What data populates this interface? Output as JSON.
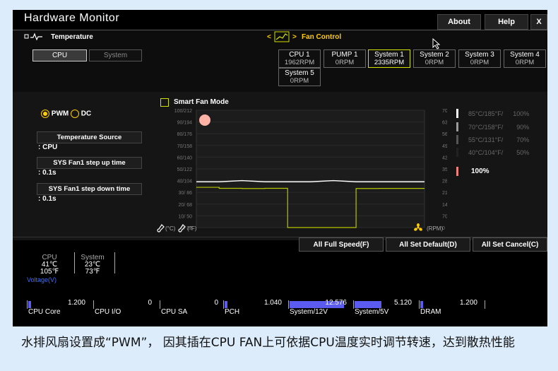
{
  "app": {
    "title": "Hardware Monitor"
  },
  "topbar": {
    "about": "About",
    "help": "Help",
    "close": "X"
  },
  "temperature": {
    "label": "Temperature",
    "tabs": [
      "CPU",
      "System"
    ]
  },
  "fan_control": {
    "label": "Fan Control",
    "prev": "<",
    "next": ">"
  },
  "fans": [
    {
      "name": "CPU 1",
      "rpm": "1962RPM"
    },
    {
      "name": "PUMP 1",
      "rpm": "0RPM"
    },
    {
      "name": "System 1",
      "rpm": "2335RPM",
      "selected": true
    },
    {
      "name": "System 2",
      "rpm": "0RPM"
    },
    {
      "name": "System 3",
      "rpm": "0RPM"
    },
    {
      "name": "System 4",
      "rpm": "0RPM"
    },
    {
      "name": "System 5",
      "rpm": "0RPM"
    }
  ],
  "mode": {
    "pwm": "PWM",
    "dc": "DC",
    "selected": "PWM"
  },
  "settings": {
    "temp_source_label": "Temperature Source",
    "temp_source_value": ": CPU",
    "step_up_label": "SYS Fan1 step up time",
    "step_up_value": ": 0.1s",
    "step_down_label": "SYS Fan1 step down time",
    "step_down_value": ": 0.1s"
  },
  "smart_fan": {
    "label": "Smart Fan Mode",
    "checked": false
  },
  "chart": {
    "left_ticks": [
      "100/212",
      "90/194",
      "80/176",
      "70/158",
      "60/140",
      "50/122",
      "40/104",
      "30/ 86",
      "20/ 68",
      "10/ 50",
      "0/ 32"
    ],
    "right_ticks": [
      "7000",
      "6300",
      "5600",
      "4900",
      "4200",
      "3500",
      "2800",
      "2100",
      "1400",
      "700",
      "0"
    ],
    "left_unit_c": "(°C)",
    "left_unit_f": "(°F)",
    "right_unit": "(RPM)",
    "legend": [
      {
        "text": "85°C/185°F/",
        "pct": "100%",
        "color": "#ffffff"
      },
      {
        "text": "70°C/158°F/",
        "pct": "90%",
        "color": "#9a9a9a"
      },
      {
        "text": "55°C/131°F/",
        "pct": "70%",
        "color": "#555555"
      },
      {
        "text": "40°C/104°F/",
        "pct": "50%",
        "color": "#222222"
      }
    ],
    "current_pct": "100%"
  },
  "chart_data": {
    "type": "line",
    "title": "",
    "xlabel": "",
    "ylabel": "(°C)",
    "y2label": "(RPM)",
    "ylim": [
      0,
      100
    ],
    "y2lim": [
      0,
      7000
    ],
    "grid": true,
    "series": [
      {
        "x": [
          0,
          1,
          2,
          3,
          4,
          5,
          6,
          7,
          8,
          9,
          10
        ],
        "values": [
          39,
          39,
          40,
          39,
          39,
          39,
          40,
          39,
          39,
          39,
          39
        ],
        "color": "#ffffff"
      },
      {
        "x": [
          0,
          1,
          2,
          3,
          4,
          5,
          6,
          7,
          8,
          9,
          10
        ],
        "values": [
          2400,
          2340,
          2330,
          2340,
          0,
          0,
          0,
          2330,
          2335,
          2335,
          2335
        ],
        "color": "#b5c400"
      }
    ]
  },
  "actions": {
    "full_speed": "All Full Speed(F)",
    "set_default": "All Set Default(D)",
    "set_cancel": "All Set Cancel(C)"
  },
  "monitor": {
    "cpu": {
      "label": "CPU",
      "c": "41℃",
      "f": "105℉"
    },
    "system": {
      "label": "System",
      "c": "23℃",
      "f": "73℉"
    },
    "voltage_label": "Voltage(V)"
  },
  "voltages": [
    {
      "name": "CPU Core",
      "value": "1.200",
      "fill": 0.04
    },
    {
      "name": "CPU I/O",
      "value": "0",
      "fill": 0
    },
    {
      "name": "CPU SA",
      "value": "0",
      "fill": 0
    },
    {
      "name": "PCH",
      "value": "1.040",
      "fill": 0.04
    },
    {
      "name": "System/12V",
      "value": "12.576",
      "fill": 0.9
    },
    {
      "name": "System/5V",
      "value": "5.120",
      "fill": 0.45
    },
    {
      "name": "DRAM",
      "value": "1.200",
      "fill": 0.04
    }
  ],
  "caption": "水排风扇设置成“PWM”， 因其插在CPU FAN上可依据CPU温度实时调节转速，达到散热性能"
}
